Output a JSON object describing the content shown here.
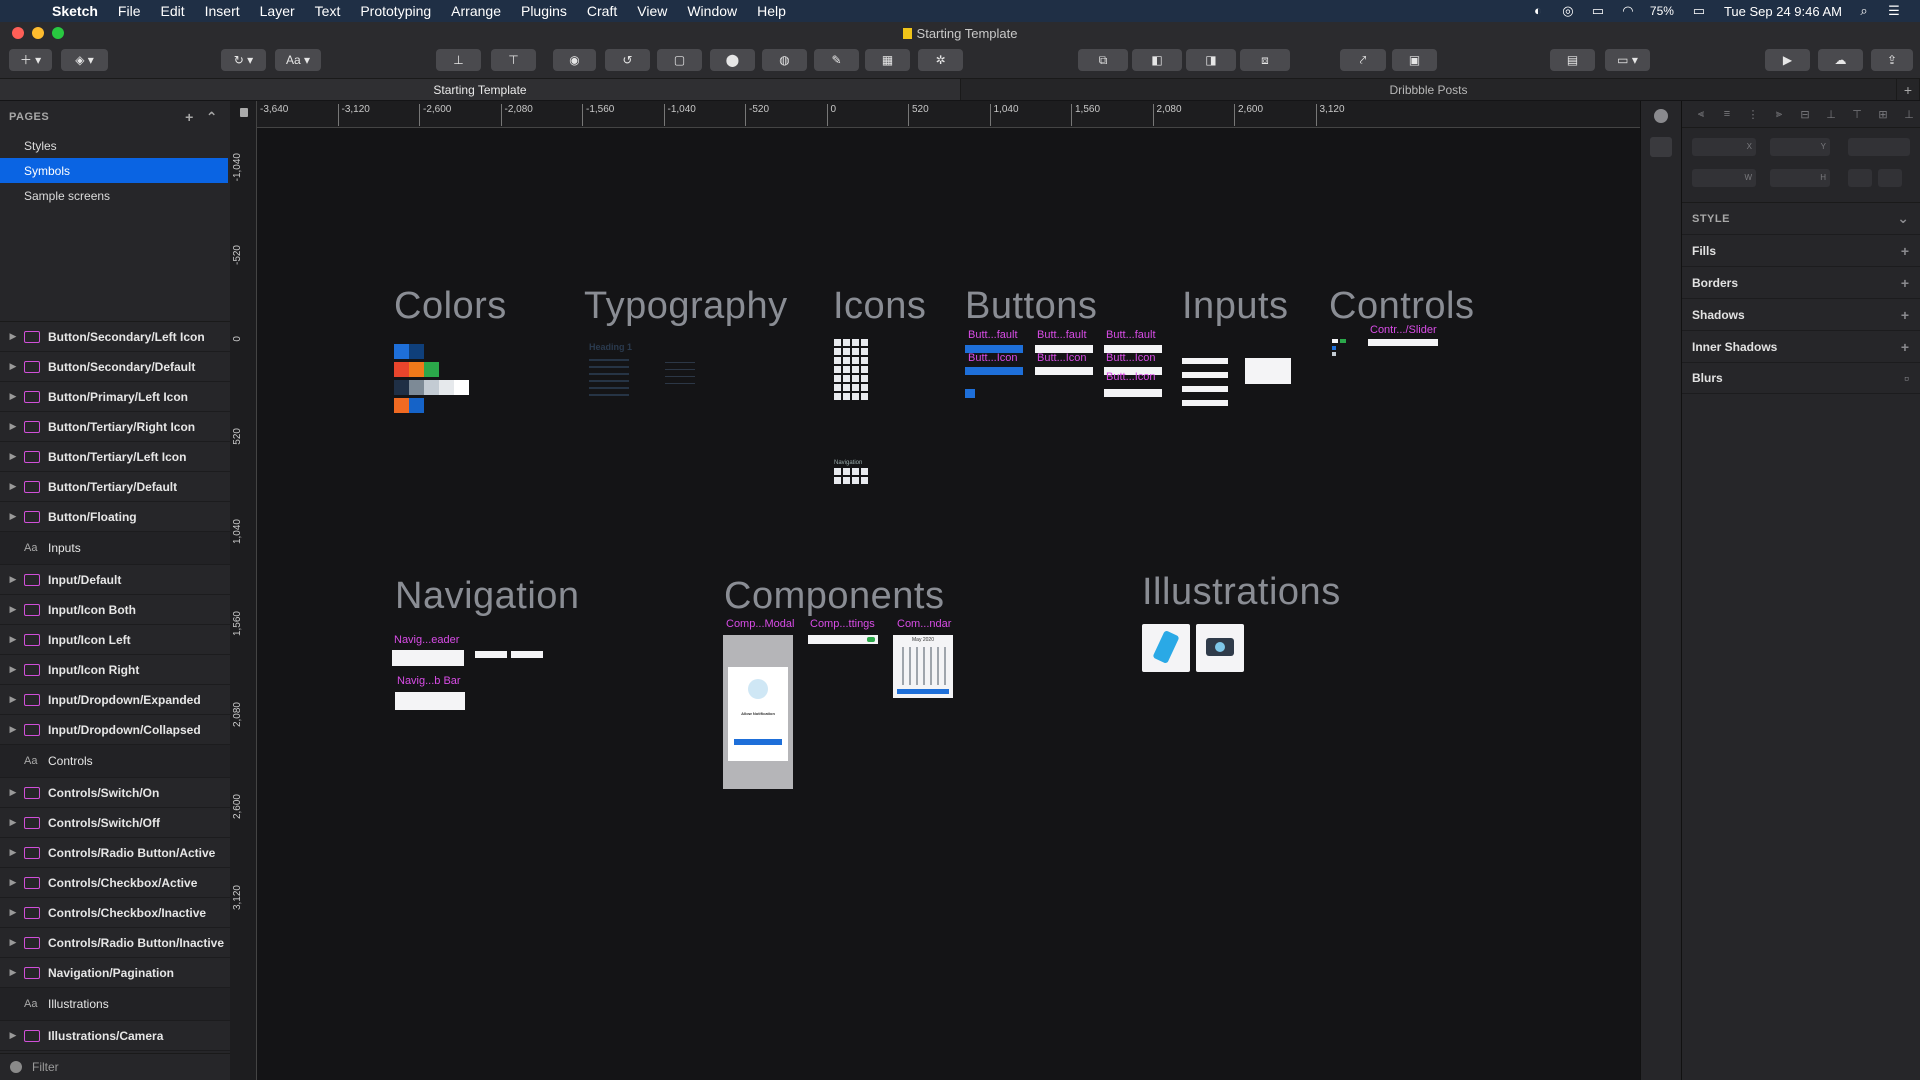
{
  "menubar": {
    "app_name": "Sketch",
    "items": [
      "File",
      "Edit",
      "Insert",
      "Layer",
      "Text",
      "Prototyping",
      "Arrange",
      "Plugins",
      "Craft",
      "View",
      "Window",
      "Help"
    ],
    "battery": "75%",
    "datetime": "Tue Sep 24  9:46 AM"
  },
  "window": {
    "title": "Starting Template"
  },
  "toolbar": {
    "text_style_label": "Aa"
  },
  "tabs": [
    "Starting Template",
    "Dribbble Posts"
  ],
  "sidebar": {
    "pages_header": "PAGES",
    "pages": [
      {
        "label": "Styles",
        "selected": false
      },
      {
        "label": "Symbols",
        "selected": true
      },
      {
        "label": "Sample screens",
        "selected": false
      }
    ],
    "layers": [
      {
        "label": "Button/Secondary/Left Icon",
        "kind": "symbol"
      },
      {
        "label": "Button/Secondary/Default",
        "kind": "symbol"
      },
      {
        "label": "Button/Primary/Left Icon",
        "kind": "symbol"
      },
      {
        "label": "Button/Tertiary/Right Icon",
        "kind": "symbol"
      },
      {
        "label": "Button/Tertiary/Left Icon",
        "kind": "symbol"
      },
      {
        "label": "Button/Tertiary/Default",
        "kind": "symbol"
      },
      {
        "label": "Button/Floating",
        "kind": "symbol"
      },
      {
        "label": "Inputs",
        "kind": "text"
      },
      {
        "label": "Input/Default",
        "kind": "symbol"
      },
      {
        "label": "Input/Icon Both",
        "kind": "symbol"
      },
      {
        "label": "Input/Icon Left",
        "kind": "symbol"
      },
      {
        "label": "Input/Icon Right",
        "kind": "symbol"
      },
      {
        "label": "Input/Dropdown/Expanded",
        "kind": "symbol"
      },
      {
        "label": "Input/Dropdown/Collapsed",
        "kind": "symbol"
      },
      {
        "label": "Controls",
        "kind": "text"
      },
      {
        "label": "Controls/Switch/On",
        "kind": "symbol"
      },
      {
        "label": "Controls/Switch/Off",
        "kind": "symbol"
      },
      {
        "label": "Controls/Radio Button/Active",
        "kind": "symbol"
      },
      {
        "label": "Controls/Checkbox/Active",
        "kind": "symbol"
      },
      {
        "label": "Controls/Checkbox/Inactive",
        "kind": "symbol"
      },
      {
        "label": "Controls/Radio Button/Inactive",
        "kind": "symbol"
      },
      {
        "label": "Navigation/Pagination",
        "kind": "symbol"
      },
      {
        "label": "Illustrations",
        "kind": "text"
      },
      {
        "label": "Illustrations/Camera",
        "kind": "symbol"
      }
    ],
    "filter_placeholder": "Filter"
  },
  "rulers": {
    "horizontal": [
      "-3,640",
      "-3,120",
      "-2,600",
      "-2,080",
      "-1,560",
      "-1,040",
      "-520",
      "0",
      "520",
      "1,040",
      "1,560",
      "2,080",
      "2,600",
      "3,120"
    ],
    "vertical": [
      "-1,040",
      "-520",
      "0",
      "520",
      "1,040",
      "1,560",
      "2,080",
      "2,600",
      "3,120"
    ]
  },
  "canvas": {
    "sections": {
      "colors": "Colors",
      "typography": "Typography",
      "icons": "Icons",
      "buttons": "Buttons",
      "inputs": "Inputs",
      "controls": "Controls",
      "navigation": "Navigation",
      "components": "Components",
      "illustrations": "Illustrations"
    },
    "labels": {
      "btn1": "Butt...fault",
      "btn2": "Butt...fault",
      "btn3": "Butt...fault",
      "btn4": "Butt...Icon",
      "btn5": "Butt...Icon",
      "btn6": "Butt...Icon",
      "btn7": "Butt...Icon",
      "slider": "Contr.../Slider",
      "nav_header": "Navig...eader",
      "nav_tabbar": "Navig...b Bar",
      "comp_modal": "Comp...Modal",
      "comp_settings": "Comp...ttings",
      "comp_calendar": "Com...ndar",
      "typo_heading1": "Heading 1",
      "icons_nav_label": "Navigation",
      "modal_title": "Allow Notification",
      "calendar_month": "May 2020"
    },
    "swatch_colors": [
      "#1e6fd9",
      "#0f3f7a",
      "#e8452c",
      "#f07a1a",
      "#2ba84a",
      "#1f2f45",
      "#7d8a96",
      "#c3cbd3",
      "#e6e9ec",
      "#ffffff",
      "#f06a22",
      "#1563c8"
    ]
  },
  "inspector": {
    "field_labels": [
      "X",
      "Y",
      "",
      "W",
      "H"
    ],
    "style_header": "STYLE",
    "sections": [
      "Fills",
      "Borders",
      "Shadows",
      "Inner Shadows",
      "Blurs"
    ]
  }
}
